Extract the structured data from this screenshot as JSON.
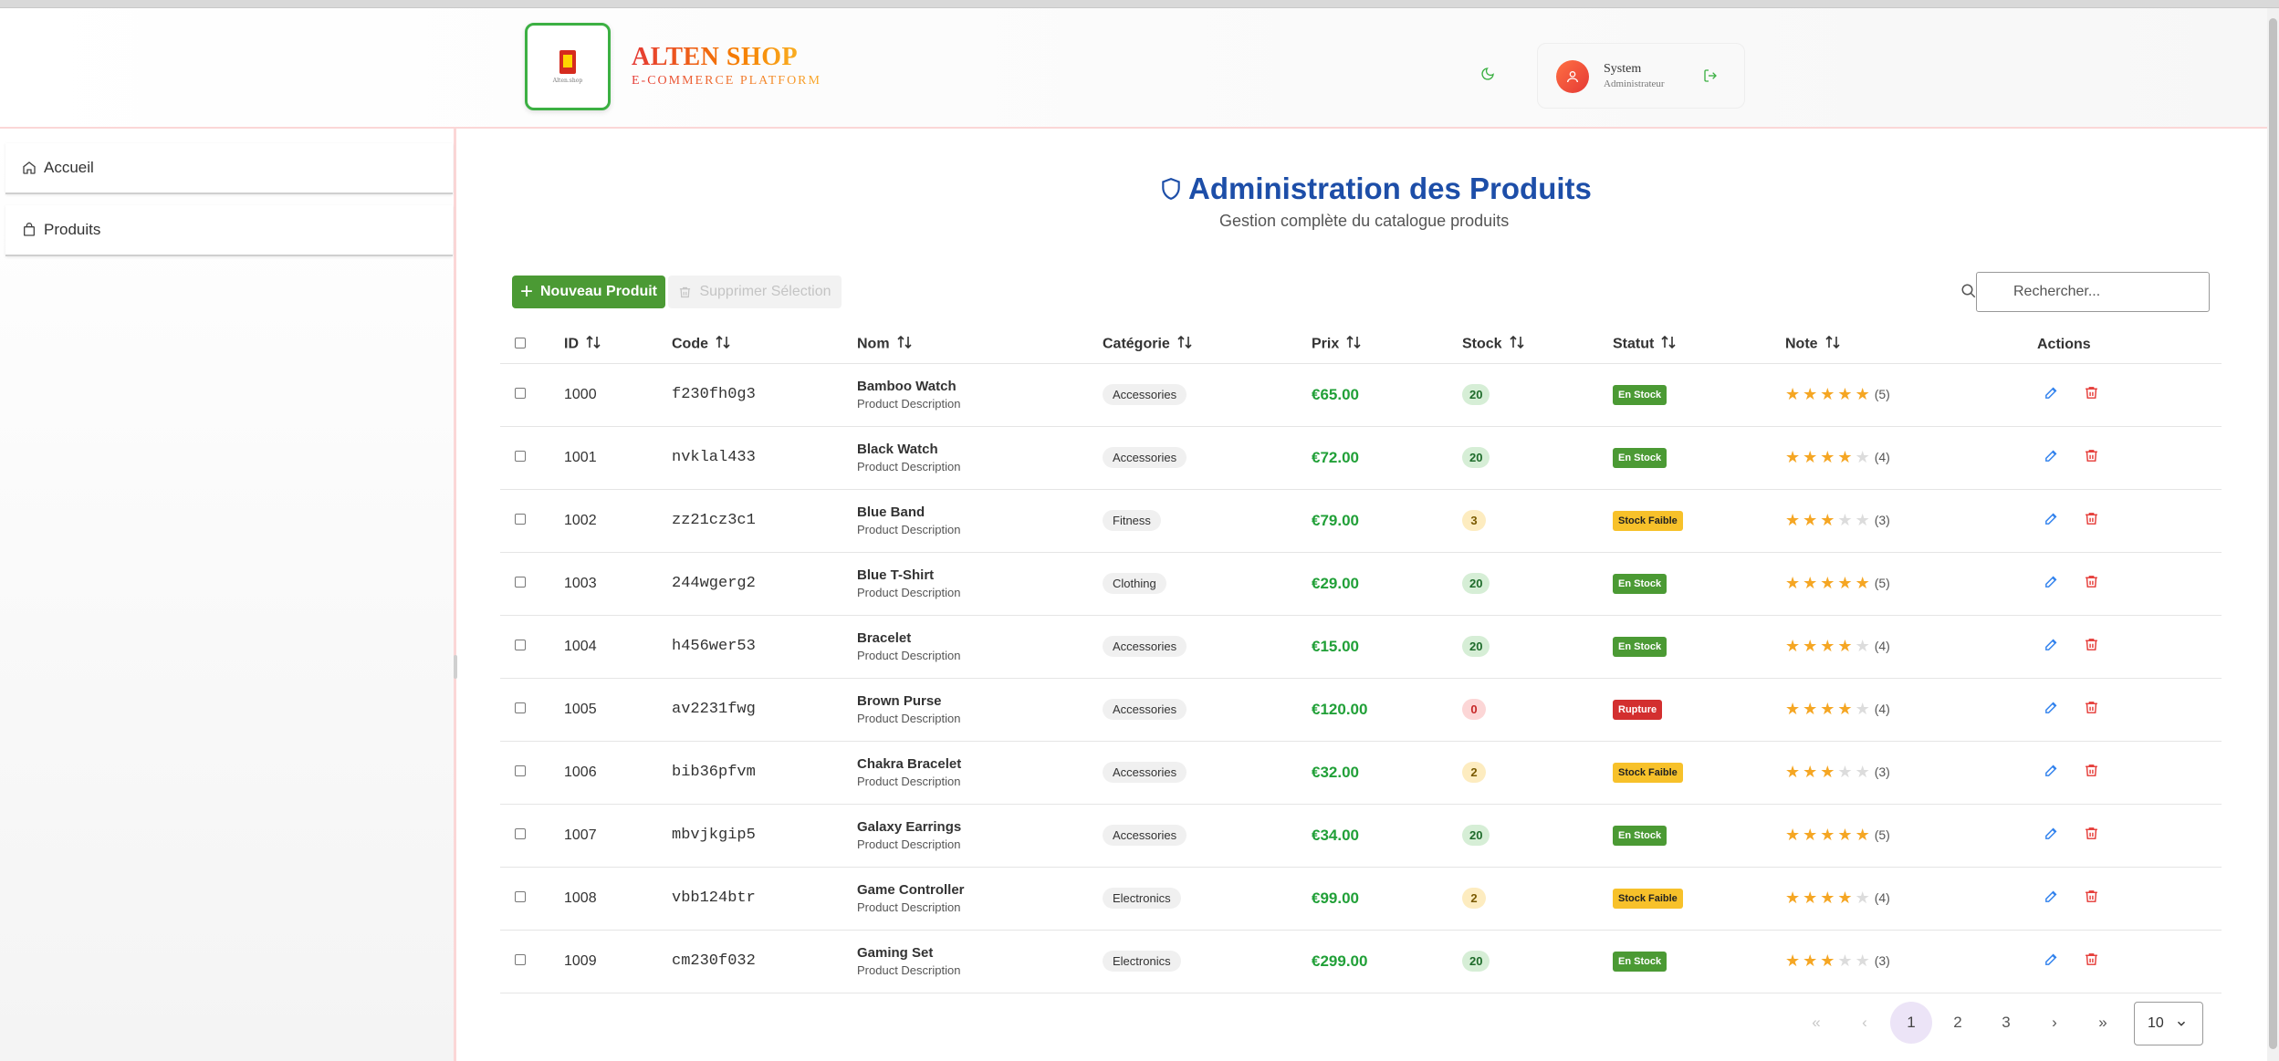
{
  "brand": {
    "title": "ALTEN SHOP",
    "subtitle": "E-COMMERCE PLATFORM",
    "logo_text": "Alten.shop"
  },
  "user": {
    "name": "System",
    "role": "Administrateur"
  },
  "sidebar": {
    "items": [
      {
        "label": "Accueil",
        "icon": "home-icon"
      },
      {
        "label": "Produits",
        "icon": "shopping-bag-icon"
      }
    ]
  },
  "page": {
    "title": "Administration des Produits",
    "subtitle": "Gestion complète du catalogue produits"
  },
  "toolbar": {
    "new_label": "Nouveau Produit",
    "delete_label": "Supprimer Sélection",
    "search_placeholder": "Rechercher..."
  },
  "table": {
    "headers": {
      "id": "ID",
      "code": "Code",
      "name": "Nom",
      "category": "Catégorie",
      "price": "Prix",
      "stock": "Stock",
      "status": "Statut",
      "rating": "Note",
      "actions": "Actions"
    },
    "rows": [
      {
        "id": "1000",
        "code": "f230fh0g3",
        "name": "Bamboo Watch",
        "desc": "Product Description",
        "category": "Accessories",
        "price": "€65.00",
        "stock": "20",
        "stock_level": "ok",
        "status": "En Stock",
        "status_level": "ok",
        "rating": 5,
        "rating_label": "(5)"
      },
      {
        "id": "1001",
        "code": "nvklal433",
        "name": "Black Watch",
        "desc": "Product Description",
        "category": "Accessories",
        "price": "€72.00",
        "stock": "20",
        "stock_level": "ok",
        "status": "En Stock",
        "status_level": "ok",
        "rating": 4,
        "rating_label": "(4)"
      },
      {
        "id": "1002",
        "code": "zz21cz3c1",
        "name": "Blue Band",
        "desc": "Product Description",
        "category": "Fitness",
        "price": "€79.00",
        "stock": "3",
        "stock_level": "low",
        "status": "Stock Faible",
        "status_level": "low",
        "rating": 3,
        "rating_label": "(3)"
      },
      {
        "id": "1003",
        "code": "244wgerg2",
        "name": "Blue T-Shirt",
        "desc": "Product Description",
        "category": "Clothing",
        "price": "€29.00",
        "stock": "20",
        "stock_level": "ok",
        "status": "En Stock",
        "status_level": "ok",
        "rating": 5,
        "rating_label": "(5)"
      },
      {
        "id": "1004",
        "code": "h456wer53",
        "name": "Bracelet",
        "desc": "Product Description",
        "category": "Accessories",
        "price": "€15.00",
        "stock": "20",
        "stock_level": "ok",
        "status": "En Stock",
        "status_level": "ok",
        "rating": 4,
        "rating_label": "(4)"
      },
      {
        "id": "1005",
        "code": "av2231fwg",
        "name": "Brown Purse",
        "desc": "Product Description",
        "category": "Accessories",
        "price": "€120.00",
        "stock": "0",
        "stock_level": "out",
        "status": "Rupture",
        "status_level": "out",
        "rating": 4,
        "rating_label": "(4)"
      },
      {
        "id": "1006",
        "code": "bib36pfvm",
        "name": "Chakra Bracelet",
        "desc": "Product Description",
        "category": "Accessories",
        "price": "€32.00",
        "stock": "2",
        "stock_level": "low",
        "status": "Stock Faible",
        "status_level": "low",
        "rating": 3,
        "rating_label": "(3)"
      },
      {
        "id": "1007",
        "code": "mbvjkgip5",
        "name": "Galaxy Earrings",
        "desc": "Product Description",
        "category": "Accessories",
        "price": "€34.00",
        "stock": "20",
        "stock_level": "ok",
        "status": "En Stock",
        "status_level": "ok",
        "rating": 5,
        "rating_label": "(5)"
      },
      {
        "id": "1008",
        "code": "vbb124btr",
        "name": "Game Controller",
        "desc": "Product Description",
        "category": "Electronics",
        "price": "€99.00",
        "stock": "2",
        "stock_level": "low",
        "status": "Stock Faible",
        "status_level": "low",
        "rating": 4,
        "rating_label": "(4)"
      },
      {
        "id": "1009",
        "code": "cm230f032",
        "name": "Gaming Set",
        "desc": "Product Description",
        "category": "Electronics",
        "price": "€299.00",
        "stock": "20",
        "stock_level": "ok",
        "status": "En Stock",
        "status_level": "ok",
        "rating": 3,
        "rating_label": "(3)"
      }
    ]
  },
  "pagination": {
    "first": "«",
    "prev": "‹",
    "pages": [
      "1",
      "2",
      "3"
    ],
    "current": "1",
    "next": "›",
    "last": "»",
    "per_page": "10"
  },
  "colors": {
    "accent_green": "#4b9a34",
    "title_blue": "#1d4ea8",
    "price_green": "#21a038",
    "danger": "#d32f2f",
    "warning": "#f7c12a"
  }
}
